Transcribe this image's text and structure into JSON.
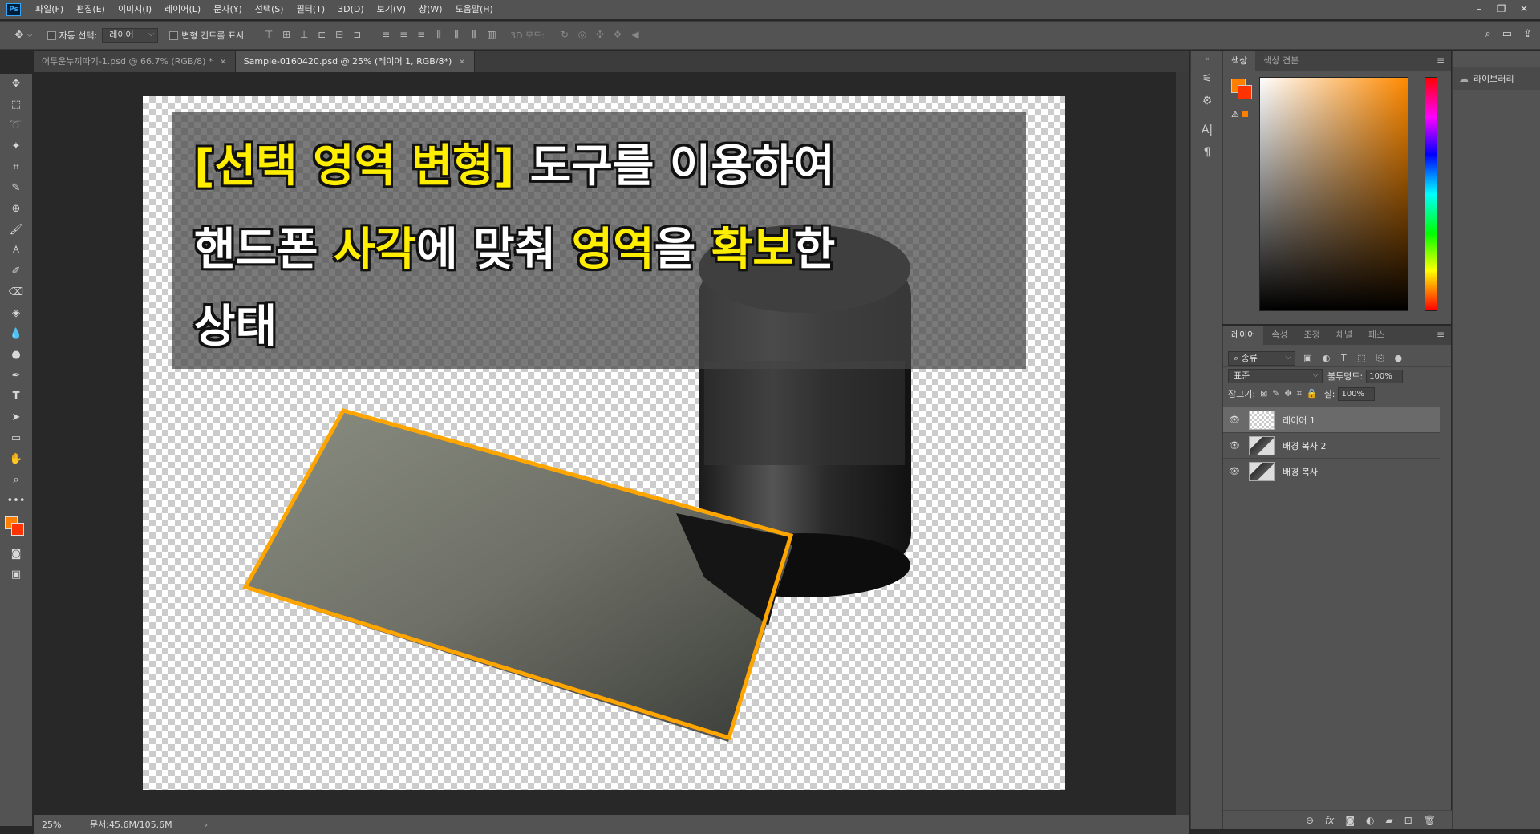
{
  "app": {
    "logo": "Ps",
    "menu": [
      "파일(F)",
      "편집(E)",
      "이미지(I)",
      "레이어(L)",
      "문자(Y)",
      "선택(S)",
      "필터(T)",
      "3D(D)",
      "보기(V)",
      "창(W)",
      "도움말(H)"
    ],
    "window_controls": [
      "–",
      "❐",
      "✕"
    ]
  },
  "options": {
    "auto_select_label": "자동 선택:",
    "auto_select_value": "레이어",
    "transform_controls_label": "변형 컨트롤 표시",
    "mode_3d_label": "3D 모드:"
  },
  "tabs": [
    {
      "label": "어두운누끼따기-1.psd @ 66.7% (RGB/8) *",
      "active": false
    },
    {
      "label": "Sample-0160420.psd @ 25% (레이어 1, RGB/8*)",
      "active": true
    }
  ],
  "canvas": {
    "caption_line1": {
      "pre": "",
      "hl": "[선택 영역 변형]",
      "post": " 도구를 이용하여"
    },
    "caption_line2_parts": [
      "핸드폰 ",
      "사각",
      "에 맞춰 ",
      "영역",
      "을 ",
      "확보",
      "한"
    ],
    "caption_line3": "상태"
  },
  "status": {
    "zoom": "25%",
    "doc": "문서:45.6M/105.6M"
  },
  "color_panel": {
    "tabs": [
      "색상",
      "색상 견본"
    ],
    "fg": "#ff8000",
    "bg": "#ff3300"
  },
  "layers_panel": {
    "tabs": [
      "레이어",
      "속성",
      "조정",
      "채널",
      "패스"
    ],
    "filter_label": "종류",
    "blend_mode": "표준",
    "opacity_label": "불투명도:",
    "opacity_value": "100%",
    "lock_label": "잠그기:",
    "fill_label": "칠:",
    "fill_value": "100%",
    "layers": [
      {
        "name": "레이어 1",
        "active": true
      },
      {
        "name": "배경 복사 2",
        "active": false
      },
      {
        "name": "배경 복사",
        "active": false
      }
    ]
  },
  "libraries": {
    "label": "라이브러리"
  },
  "colors": {
    "accent_orange": "#ff8000",
    "highlight_yellow": "#ffee00",
    "phone_outline": "#ffa500"
  }
}
